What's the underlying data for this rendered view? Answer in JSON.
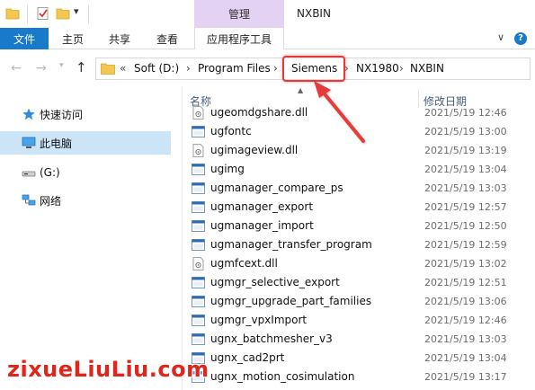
{
  "quick_access_toolbar": {
    "icons": [
      "folder-icon",
      "properties-check-icon",
      "new-folder-icon"
    ],
    "customize_glyph": "▾"
  },
  "window": {
    "context_group_label": "管理",
    "title": "NXBIN"
  },
  "ribbon": {
    "tabs": [
      {
        "label": "文件",
        "active": true
      },
      {
        "label": "主页"
      },
      {
        "label": "共享"
      },
      {
        "label": "查看"
      },
      {
        "label": "应用程序工具"
      }
    ],
    "expand_glyph": "∨",
    "help_glyph": "?"
  },
  "navigation": {
    "back_glyph": "←",
    "forward_glyph": "→",
    "recent_glyph": "▾",
    "up_glyph": "↑"
  },
  "address_bar": {
    "overflow": "«",
    "separator": "›",
    "crumbs": [
      "Soft (D:)",
      "Program Files",
      "Siemens",
      "NX1980",
      "NXBIN"
    ],
    "highlighted_crumb": "Siemens"
  },
  "sidebar": {
    "items": [
      {
        "label": "快速访问",
        "icon": "star-icon"
      },
      {
        "label": "此电脑",
        "icon": "computer-icon",
        "selected": true
      },
      {
        "label": "(G:)",
        "icon": "drive-icon"
      },
      {
        "label": "网络",
        "icon": "network-icon"
      }
    ]
  },
  "file_list": {
    "columns": {
      "name": "名称",
      "date": "修改日期"
    },
    "rows": [
      {
        "name": "ugeomdgshare.dll",
        "date": "2021/5/19 12:46",
        "icon": "dll-file-icon"
      },
      {
        "name": "ugfontc",
        "date": "2021/5/19 13:00",
        "icon": "exe-file-icon"
      },
      {
        "name": "ugimageview.dll",
        "date": "2021/5/19 13:19",
        "icon": "dll-file-icon"
      },
      {
        "name": "ugimg",
        "date": "2021/5/19 13:04",
        "icon": "exe-file-icon"
      },
      {
        "name": "ugmanager_compare_ps",
        "date": "2021/5/19 13:03",
        "icon": "exe-file-icon"
      },
      {
        "name": "ugmanager_export",
        "date": "2021/5/19 12:57",
        "icon": "exe-file-icon"
      },
      {
        "name": "ugmanager_import",
        "date": "2021/5/19 12:50",
        "icon": "exe-file-icon"
      },
      {
        "name": "ugmanager_transfer_program",
        "date": "2021/5/19 12:59",
        "icon": "exe-file-icon"
      },
      {
        "name": "ugmfcext.dll",
        "date": "2021/5/19 13:02",
        "icon": "dll-file-icon"
      },
      {
        "name": "ugmgr_selective_export",
        "date": "2021/5/19 12:51",
        "icon": "exe-file-icon"
      },
      {
        "name": "ugmgr_upgrade_part_families",
        "date": "2021/5/19 13:06",
        "icon": "exe-file-icon"
      },
      {
        "name": "ugmgr_vpxImport",
        "date": "2021/5/19 12:46",
        "icon": "exe-file-icon"
      },
      {
        "name": "ugnx_batchmesher_v3",
        "date": "2021/5/19 13:03",
        "icon": "exe-file-icon"
      },
      {
        "name": "ugnx_cad2prt",
        "date": "2021/5/19 13:04",
        "icon": "exe-file-icon"
      },
      {
        "name": "ugnx_motion_cosimulation",
        "date": "2021/5/19 13:17",
        "icon": "exe-file-icon"
      }
    ]
  },
  "colors": {
    "accent_blue": "#1979ca",
    "context_tab": "#e3d2f1",
    "selected_row": "#cce4f7",
    "annotation_red": "#e63a3a",
    "watermark_red": "#e0251b"
  },
  "watermark": {
    "text": "zixueLiuLiu.com"
  }
}
